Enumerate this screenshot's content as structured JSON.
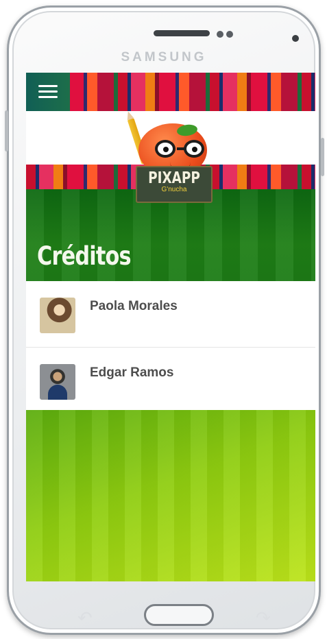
{
  "device": {
    "brand": "SAMSUNG"
  },
  "app": {
    "logo": {
      "name": "PIXAPP",
      "tagline": "G'nucha"
    },
    "page_title": "Créditos",
    "credits": [
      {
        "name": "Paola Morales"
      },
      {
        "name": "Edgar Ramos"
      }
    ]
  },
  "icons": {
    "menu": "hamburger-menu-icon",
    "back": "back-arrow-icon",
    "recent": "recent-apps-icon"
  },
  "colors": {
    "header_green": "#1f7f16",
    "lime": "#bde41b",
    "title_text": "#f4f8ec",
    "name_text": "#4d4d4d",
    "accent_red": "#e0103f"
  }
}
